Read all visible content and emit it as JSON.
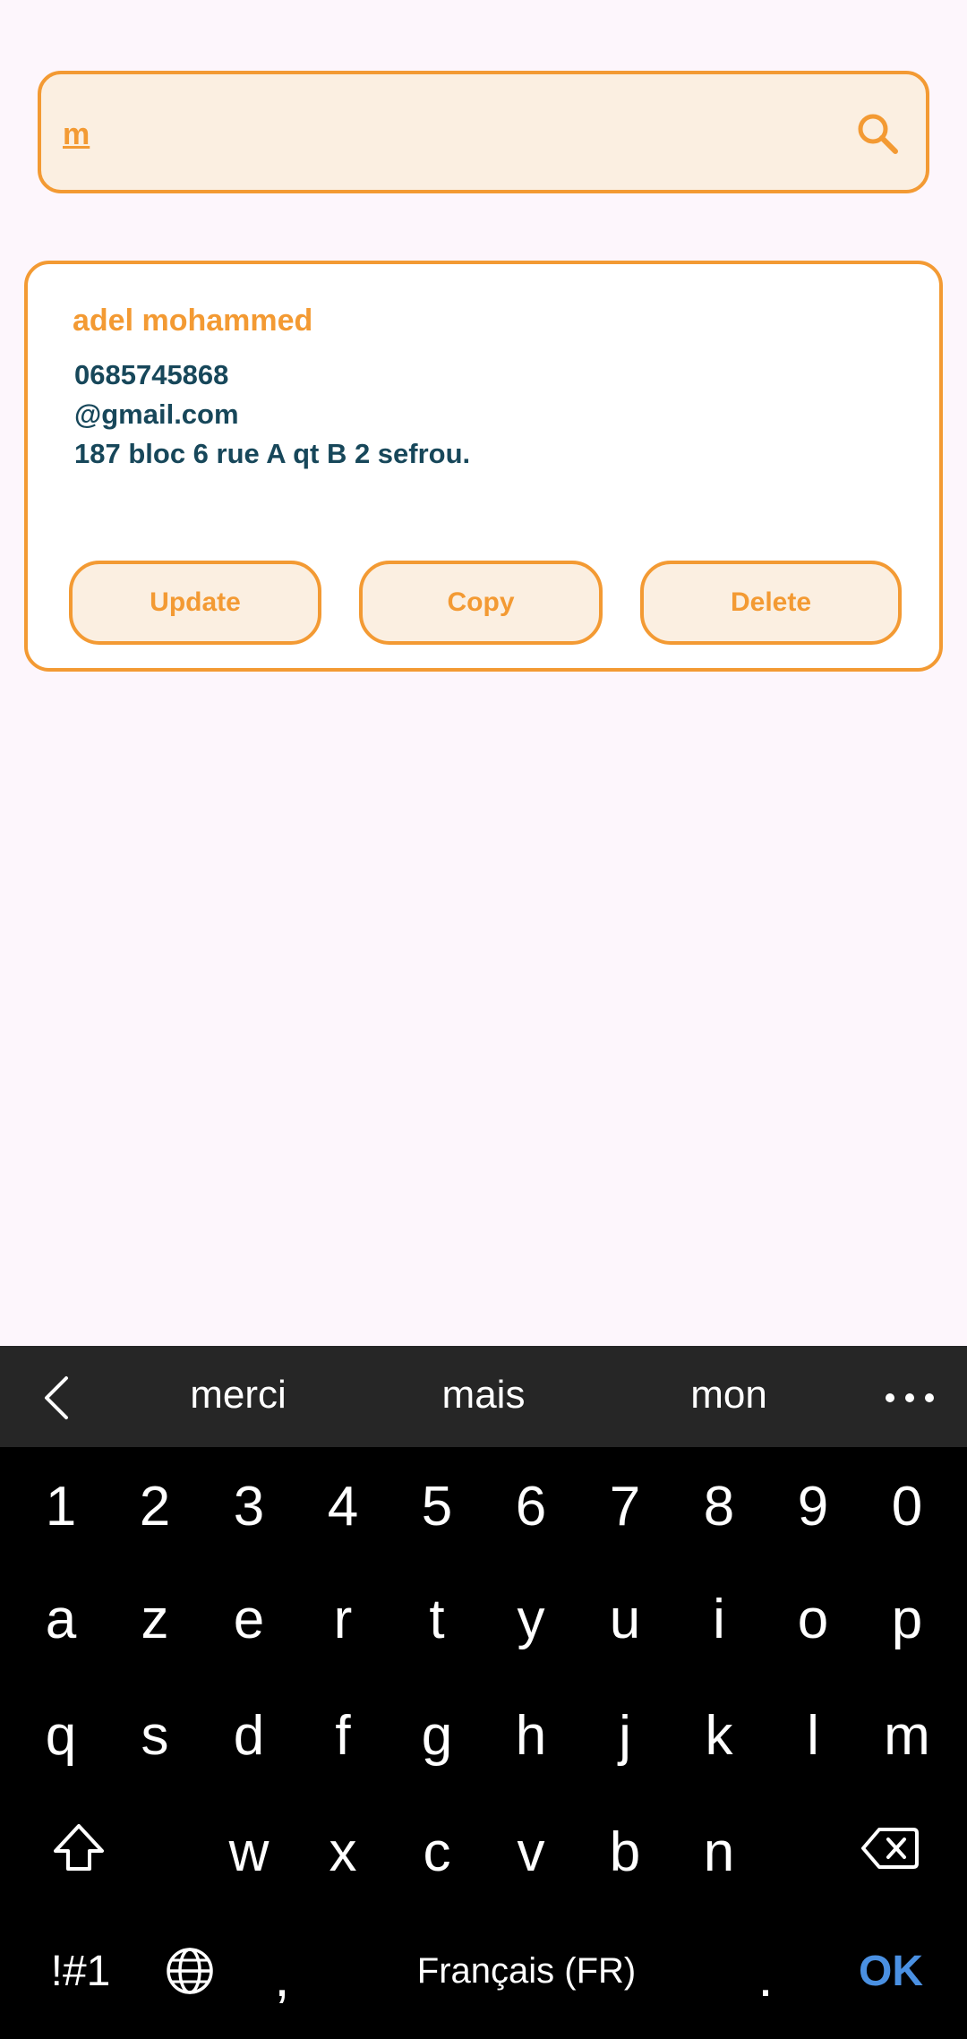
{
  "search": {
    "value": "m",
    "icon": "search-icon"
  },
  "contact": {
    "name": "adel mohammed",
    "phone": "0685745868",
    "email": "@gmail.com",
    "address": "187 bloc 6 rue A qt B 2 sefrou."
  },
  "actions": {
    "update": "Update",
    "copy": "Copy",
    "delete": "Delete"
  },
  "keyboard": {
    "suggestions": [
      "merci",
      "mais",
      "mon"
    ],
    "row_numbers": [
      "1",
      "2",
      "3",
      "4",
      "5",
      "6",
      "7",
      "8",
      "9",
      "0"
    ],
    "row1": [
      "a",
      "z",
      "e",
      "r",
      "t",
      "y",
      "u",
      "i",
      "o",
      "p"
    ],
    "row2": [
      "q",
      "s",
      "d",
      "f",
      "g",
      "h",
      "j",
      "k",
      "l",
      "m"
    ],
    "row3": [
      "w",
      "x",
      "c",
      "v",
      "b",
      "n"
    ],
    "symbols_label": "!#1",
    "comma": ",",
    "space_label": "Français (FR)",
    "period": ".",
    "ok_label": "OK"
  },
  "colors": {
    "accent": "#f39a33",
    "text_dark": "#17475a",
    "ok_blue": "#4a90e2"
  }
}
